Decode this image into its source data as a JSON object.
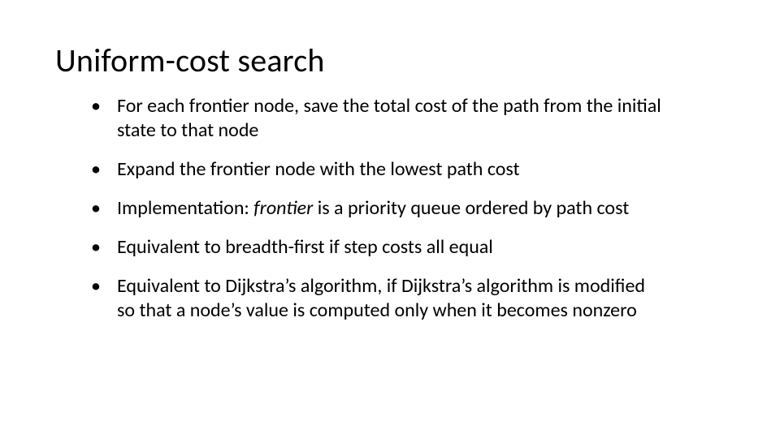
{
  "slide": {
    "title": "Uniform-cost search",
    "bullets": [
      {
        "pre": "For each frontier node, save the total cost of the path from the initial state to that node",
        "ital": "",
        "post": ""
      },
      {
        "pre": "Expand the frontier node with the lowest path cost",
        "ital": "",
        "post": ""
      },
      {
        "pre": "Implementation: ",
        "ital": "frontier",
        "post": " is a priority queue ordered by path cost"
      },
      {
        "pre": "Equivalent to breadth-first if step costs all equal",
        "ital": "",
        "post": ""
      },
      {
        "pre": "Equivalent to Dijkstra’s algorithm, if Dijkstra’s algorithm is modified so that a node’s value is computed only when it becomes nonzero",
        "ital": "",
        "post": ""
      }
    ]
  }
}
